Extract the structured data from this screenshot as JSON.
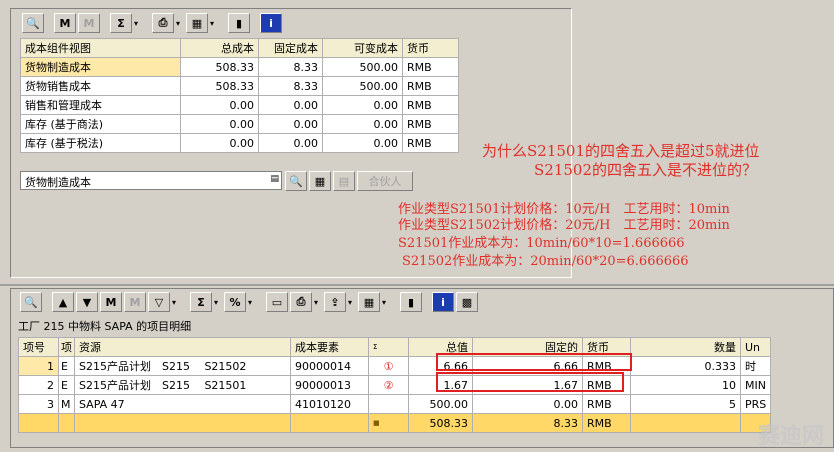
{
  "top_table": {
    "headers": [
      "成本组件视图",
      "总成本",
      "固定成本",
      "可变成本",
      "货币"
    ],
    "rows": [
      [
        "货物制造成本",
        "508.33",
        "8.33",
        "500.00",
        "RMB"
      ],
      [
        "货物销售成本",
        "508.33",
        "8.33",
        "500.00",
        "RMB"
      ],
      [
        "销售和管理成本",
        "0.00",
        "0.00",
        "0.00",
        "RMB"
      ],
      [
        "库存 (基于商法)",
        "0.00",
        "0.00",
        "0.00",
        "RMB"
      ],
      [
        "库存 (基于税法)",
        "0.00",
        "0.00",
        "0.00",
        "RMB"
      ]
    ]
  },
  "selector": {
    "value": "货物制造成本",
    "partner_label": "合伙人"
  },
  "annotations": {
    "question_line1": "为什么S21501的四舍五入是超过5就进位",
    "question_line2": "S21502的四舍五入是不进位的？",
    "info_line1": "作业类型S21501计划价格：10元/H　工艺用时：10min",
    "info_line2": "作业类型S21502计划价格：20元/H　工艺用时：20min",
    "info_line3": "S21501作业成本为：10min/60*10=1.666666",
    "info_line4": "S21502作业成本为：20min/60*20=6.666666"
  },
  "bottom": {
    "title": "工厂 215 中物料 SAPA 的项目明细",
    "headers": [
      "项号",
      "项",
      "资源",
      "成本要素",
      "Σ",
      "总值",
      "固定的",
      "货币",
      "数量",
      "Un"
    ],
    "rows": [
      [
        "1",
        "E",
        "S215产品计划　S215　 S21502",
        "90000014",
        "①",
        "6.66",
        "6.66",
        "RMB",
        "0.333",
        "时"
      ],
      [
        "2",
        "E",
        "S215产品计划　S215　 S21501",
        "90000013",
        "②",
        "1.67",
        "1.67",
        "RMB",
        "10",
        "MIN"
      ],
      [
        "3",
        "M",
        "SAPA 47",
        "41010120",
        "",
        "500.00",
        "0.00",
        "RMB",
        "5",
        "PRS"
      ]
    ],
    "totals": [
      "",
      "",
      "",
      "",
      "■",
      "508.33",
      "8.33",
      "RMB",
      "",
      ""
    ]
  },
  "watermark": "赛迪网"
}
